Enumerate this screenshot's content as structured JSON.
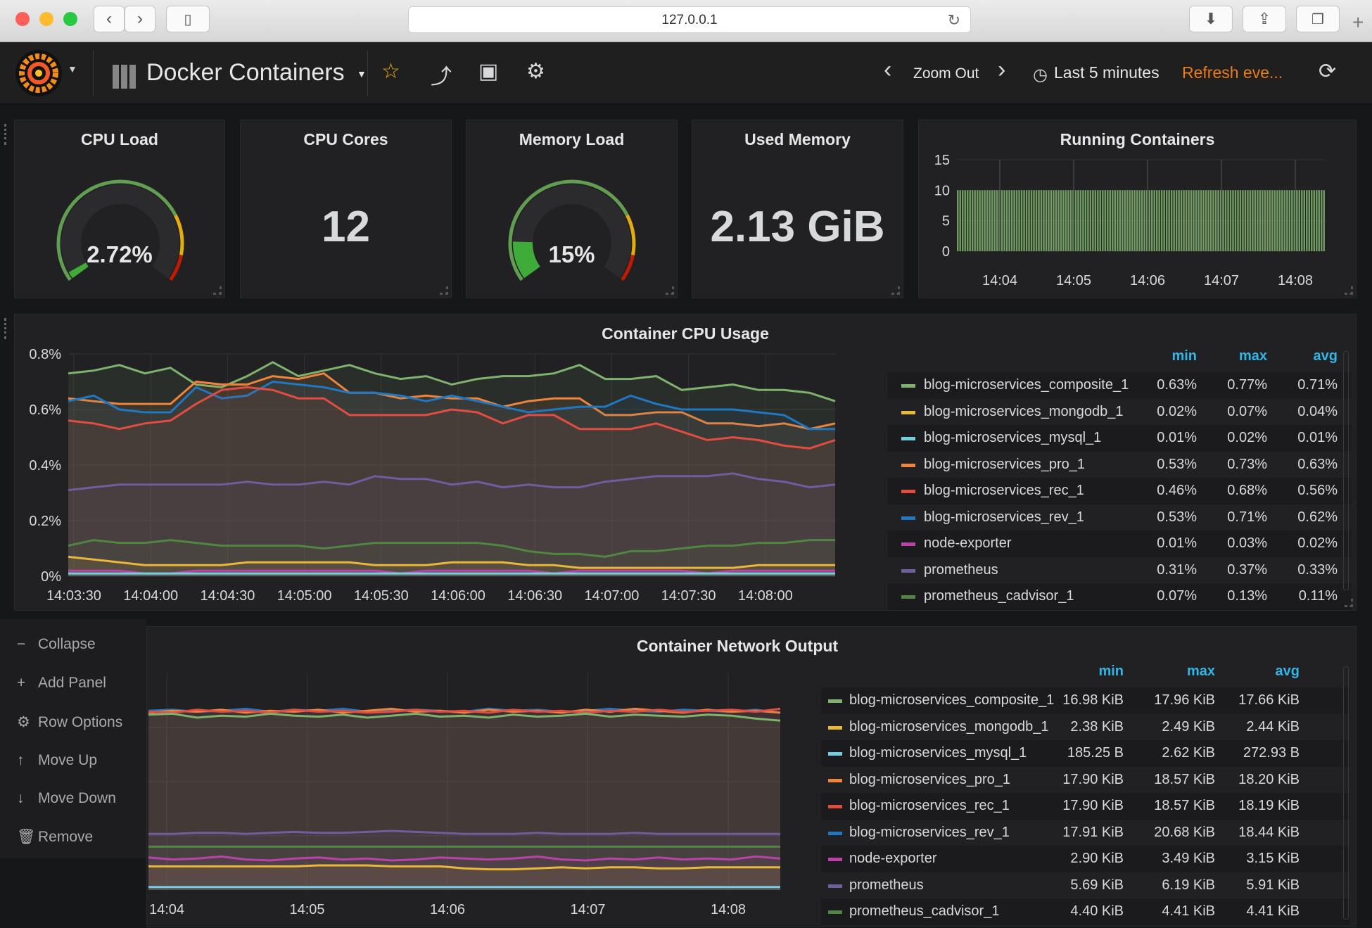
{
  "browser": {
    "url": "127.0.0.1"
  },
  "navbar": {
    "dashboard_title": "Docker Containers",
    "zoom_out": "Zoom Out",
    "time_range": "Last 5 minutes",
    "refresh": "Refresh eve..."
  },
  "stats": {
    "cpu_load": {
      "title": "CPU Load",
      "value": "2.72%",
      "fraction": 0.0272
    },
    "cpu_cores": {
      "title": "CPU Cores",
      "value": "12"
    },
    "memory_load": {
      "title": "Memory Load",
      "value": "15%",
      "fraction": 0.15
    },
    "used_memory": {
      "title": "Used Memory",
      "value": "2.13 GiB"
    },
    "running_containers": {
      "title": "Running Containers"
    }
  },
  "colors": {
    "green": "#7eb26d",
    "yellow": "#eab839",
    "cyan": "#6ed0e0",
    "orange": "#ef843c",
    "red": "#e24d42",
    "blue": "#1f78c1",
    "pink": "#ba43a9",
    "purple": "#705da0",
    "darkgreen": "#508642",
    "legend_header": "#33b5e5",
    "refresh": "#eb7b18"
  },
  "cpu_panel": {
    "title": "Container CPU Usage",
    "headers": {
      "min": "min",
      "max": "max",
      "avg": "avg"
    },
    "legend": [
      {
        "name": "blog-microservices_composite_1",
        "min": "0.63%",
        "max": "0.77%",
        "avg": "0.71%"
      },
      {
        "name": "blog-microservices_mongodb_1",
        "min": "0.02%",
        "max": "0.07%",
        "avg": "0.04%"
      },
      {
        "name": "blog-microservices_mysql_1",
        "min": "0.01%",
        "max": "0.02%",
        "avg": "0.01%"
      },
      {
        "name": "blog-microservices_pro_1",
        "min": "0.53%",
        "max": "0.73%",
        "avg": "0.63%"
      },
      {
        "name": "blog-microservices_rec_1",
        "min": "0.46%",
        "max": "0.68%",
        "avg": "0.56%"
      },
      {
        "name": "blog-microservices_rev_1",
        "min": "0.53%",
        "max": "0.71%",
        "avg": "0.62%"
      },
      {
        "name": "node-exporter",
        "min": "0.01%",
        "max": "0.03%",
        "avg": "0.02%"
      },
      {
        "name": "prometheus",
        "min": "0.31%",
        "max": "0.37%",
        "avg": "0.33%"
      },
      {
        "name": "prometheus_cadvisor_1",
        "min": "0.07%",
        "max": "0.13%",
        "avg": "0.11%"
      }
    ]
  },
  "net_panel": {
    "title": "Container Network Output",
    "headers": {
      "min": "min",
      "max": "max",
      "avg": "avg"
    },
    "legend": [
      {
        "name": "blog-microservices_composite_1",
        "min": "16.98 KiB",
        "max": "17.96 KiB",
        "avg": "17.66 KiB"
      },
      {
        "name": "blog-microservices_mongodb_1",
        "min": "2.38 KiB",
        "max": "2.49 KiB",
        "avg": "2.44 KiB"
      },
      {
        "name": "blog-microservices_mysql_1",
        "min": "185.25 B",
        "max": "2.62 KiB",
        "avg": "272.93 B"
      },
      {
        "name": "blog-microservices_pro_1",
        "min": "17.90 KiB",
        "max": "18.57 KiB",
        "avg": "18.20 KiB"
      },
      {
        "name": "blog-microservices_rec_1",
        "min": "17.90 KiB",
        "max": "18.57 KiB",
        "avg": "18.19 KiB"
      },
      {
        "name": "blog-microservices_rev_1",
        "min": "17.91 KiB",
        "max": "20.68 KiB",
        "avg": "18.44 KiB"
      },
      {
        "name": "node-exporter",
        "min": "2.90 KiB",
        "max": "3.49 KiB",
        "avg": "3.15 KiB"
      },
      {
        "name": "prometheus",
        "min": "5.69 KiB",
        "max": "6.19 KiB",
        "avg": "5.91 KiB"
      },
      {
        "name": "prometheus_cadvisor_1",
        "min": "4.40 KiB",
        "max": "4.41 KiB",
        "avg": "4.41 KiB"
      }
    ]
  },
  "row_menu": {
    "collapse": "Collapse",
    "add_panel": "Add Panel",
    "row_options": "Row Options",
    "move_up": "Move Up",
    "move_down": "Move Down",
    "remove": "Remove"
  },
  "chart_data": [
    {
      "type": "bar",
      "title": "Running Containers",
      "x_ticks": [
        "14:04",
        "14:05",
        "14:06",
        "14:07",
        "14:08"
      ],
      "y_ticks": [
        "0",
        "5",
        "10",
        "15"
      ],
      "ylim": [
        0,
        15
      ],
      "value_constant": 10
    },
    {
      "type": "area",
      "title": "Container CPU Usage",
      "x_ticks": [
        "14:03:30",
        "14:04:00",
        "14:04:30",
        "14:05:00",
        "14:05:30",
        "14:06:00",
        "14:06:30",
        "14:07:00",
        "14:07:30",
        "14:08:00"
      ],
      "y_ticks": [
        "0%",
        "0.2%",
        "0.4%",
        "0.6%",
        "0.8%"
      ],
      "ylim": [
        0,
        0.8
      ],
      "series": [
        {
          "name": "blog-microservices_composite_1",
          "color": "#7eb26d",
          "values": [
            0.73,
            0.74,
            0.76,
            0.73,
            0.75,
            0.69,
            0.68,
            0.72,
            0.77,
            0.72,
            0.74,
            0.76,
            0.73,
            0.71,
            0.72,
            0.69,
            0.71,
            0.72,
            0.72,
            0.73,
            0.76,
            0.71,
            0.71,
            0.72,
            0.67,
            0.68,
            0.69,
            0.67,
            0.67,
            0.66,
            0.63
          ]
        },
        {
          "name": "blog-microservices_pro_1",
          "color": "#ef843c",
          "values": [
            0.64,
            0.63,
            0.62,
            0.62,
            0.62,
            0.7,
            0.69,
            0.69,
            0.72,
            0.71,
            0.73,
            0.66,
            0.66,
            0.64,
            0.65,
            0.64,
            0.64,
            0.61,
            0.63,
            0.64,
            0.64,
            0.58,
            0.58,
            0.59,
            0.59,
            0.55,
            0.55,
            0.54,
            0.55,
            0.53,
            0.55
          ]
        },
        {
          "name": "blog-microservices_rev_1",
          "color": "#1f78c1",
          "values": [
            0.63,
            0.65,
            0.6,
            0.59,
            0.59,
            0.68,
            0.64,
            0.65,
            0.7,
            0.69,
            0.68,
            0.66,
            0.66,
            0.65,
            0.63,
            0.65,
            0.63,
            0.61,
            0.59,
            0.6,
            0.61,
            0.61,
            0.65,
            0.62,
            0.6,
            0.6,
            0.6,
            0.59,
            0.58,
            0.53,
            0.53
          ]
        },
        {
          "name": "blog-microservices_rec_1",
          "color": "#e24d42",
          "values": [
            0.56,
            0.55,
            0.53,
            0.55,
            0.56,
            0.62,
            0.67,
            0.68,
            0.67,
            0.64,
            0.64,
            0.58,
            0.58,
            0.58,
            0.58,
            0.6,
            0.59,
            0.55,
            0.58,
            0.58,
            0.53,
            0.53,
            0.53,
            0.55,
            0.52,
            0.49,
            0.5,
            0.49,
            0.47,
            0.46,
            0.49
          ]
        },
        {
          "name": "prometheus",
          "color": "#705da0",
          "values": [
            0.31,
            0.32,
            0.33,
            0.33,
            0.33,
            0.33,
            0.33,
            0.34,
            0.33,
            0.33,
            0.34,
            0.33,
            0.36,
            0.35,
            0.35,
            0.33,
            0.34,
            0.32,
            0.33,
            0.32,
            0.32,
            0.34,
            0.35,
            0.36,
            0.36,
            0.36,
            0.37,
            0.35,
            0.34,
            0.32,
            0.33
          ]
        },
        {
          "name": "prometheus_cadvisor_1",
          "color": "#508642",
          "values": [
            0.11,
            0.13,
            0.12,
            0.12,
            0.13,
            0.12,
            0.11,
            0.11,
            0.11,
            0.11,
            0.1,
            0.11,
            0.12,
            0.12,
            0.12,
            0.12,
            0.12,
            0.11,
            0.09,
            0.08,
            0.08,
            0.07,
            0.09,
            0.09,
            0.1,
            0.11,
            0.11,
            0.12,
            0.12,
            0.13,
            0.13
          ]
        },
        {
          "name": "blog-microservices_mongodb_1",
          "color": "#eab839",
          "values": [
            0.07,
            0.06,
            0.05,
            0.04,
            0.04,
            0.04,
            0.04,
            0.05,
            0.05,
            0.05,
            0.05,
            0.05,
            0.04,
            0.04,
            0.04,
            0.05,
            0.05,
            0.05,
            0.04,
            0.04,
            0.03,
            0.03,
            0.03,
            0.03,
            0.03,
            0.03,
            0.03,
            0.04,
            0.04,
            0.04,
            0.04
          ]
        },
        {
          "name": "node-exporter",
          "color": "#ba43a9",
          "values": [
            0.02,
            0.02,
            0.02,
            0.01,
            0.01,
            0.02,
            0.02,
            0.02,
            0.02,
            0.02,
            0.02,
            0.02,
            0.02,
            0.01,
            0.02,
            0.02,
            0.02,
            0.02,
            0.02,
            0.01,
            0.02,
            0.02,
            0.02,
            0.02,
            0.02,
            0.01,
            0.02,
            0.02,
            0.02,
            0.02,
            0.02
          ]
        },
        {
          "name": "blog-microservices_mysql_1",
          "color": "#6ed0e0",
          "values": [
            0.01,
            0.01,
            0.01,
            0.01,
            0.01,
            0.01,
            0.01,
            0.01,
            0.01,
            0.01,
            0.01,
            0.01,
            0.01,
            0.01,
            0.01,
            0.01,
            0.01,
            0.01,
            0.01,
            0.01,
            0.01,
            0.01,
            0.01,
            0.01,
            0.01,
            0.01,
            0.01,
            0.01,
            0.01,
            0.01,
            0.01
          ]
        }
      ]
    },
    {
      "type": "area",
      "title": "Container Network Output",
      "x_ticks": [
        "14:04",
        "14:05",
        "14:06",
        "14:07",
        "14:08"
      ],
      "ylim": [
        0,
        22
      ],
      "series": [
        {
          "name": "blog-microservices_rev_1",
          "color": "#1f78c1",
          "values": [
            18.2,
            18.3,
            18.1,
            18.2,
            18.4,
            18.1,
            18.3,
            18.2,
            18.4,
            18.1,
            18.2,
            18.3,
            18.2,
            18.1,
            18.4,
            18.2,
            18.3,
            18.1,
            18.2,
            18.4,
            18.2,
            18.1,
            18.3,
            18.2,
            18.1,
            18.3,
            18.0
          ]
        },
        {
          "name": "blog-microservices_pro_1",
          "color": "#ef843c",
          "values": [
            18.0,
            18.2,
            18.1,
            18.3,
            18.0,
            18.2,
            18.1,
            18.3,
            18.0,
            18.2,
            18.4,
            18.1,
            18.2,
            18.0,
            18.3,
            18.1,
            18.2,
            18.0,
            18.3,
            18.1,
            18.4,
            18.2,
            18.0,
            18.3,
            18.1,
            18.2,
            18.0
          ]
        },
        {
          "name": "blog-microservices_rec_1",
          "color": "#e24d42",
          "values": [
            18.1,
            18.0,
            18.3,
            18.1,
            18.2,
            18.0,
            18.3,
            18.1,
            18.2,
            18.0,
            18.1,
            18.3,
            18.1,
            18.2,
            18.0,
            18.3,
            18.1,
            18.2,
            18.0,
            18.2,
            18.1,
            18.3,
            18.1,
            18.2,
            18.3,
            18.1,
            18.4
          ]
        },
        {
          "name": "blog-microservices_composite_1",
          "color": "#7eb26d",
          "values": [
            17.8,
            17.9,
            17.5,
            17.7,
            17.6,
            17.9,
            17.7,
            17.6,
            17.8,
            17.5,
            17.7,
            17.9,
            17.6,
            17.7,
            17.5,
            17.8,
            17.6,
            17.7,
            17.9,
            17.6,
            17.8,
            17.7,
            17.6,
            17.8,
            17.7,
            17.4,
            17.2
          ]
        },
        {
          "name": "prometheus",
          "color": "#705da0",
          "values": [
            5.7,
            5.7,
            5.8,
            5.8,
            5.7,
            5.8,
            5.9,
            5.8,
            5.8,
            5.9,
            6.0,
            5.9,
            5.8,
            5.7,
            5.7,
            5.7,
            5.8,
            5.7,
            5.7,
            5.7,
            5.8,
            5.7,
            5.7,
            5.7,
            5.7,
            5.7,
            5.7
          ]
        },
        {
          "name": "prometheus_cadvisor_1",
          "color": "#508642",
          "values": [
            4.4,
            4.4,
            4.4,
            4.4,
            4.4,
            4.4,
            4.4,
            4.4,
            4.4,
            4.4,
            4.4,
            4.4,
            4.4,
            4.4,
            4.4,
            4.4,
            4.4,
            4.4,
            4.4,
            4.4,
            4.4,
            4.4,
            4.4,
            4.4,
            4.4,
            4.4,
            4.4
          ]
        },
        {
          "name": "node-exporter",
          "color": "#ba43a9",
          "values": [
            3.3,
            3.1,
            3.2,
            3.4,
            3.1,
            3.0,
            3.2,
            3.3,
            3.1,
            3.2,
            3.0,
            3.1,
            3.3,
            3.2,
            3.1,
            3.2,
            3.4,
            3.1,
            3.0,
            3.2,
            3.1,
            3.3,
            3.1,
            3.2,
            3.1,
            3.4,
            3.2
          ]
        },
        {
          "name": "blog-microservices_mongodb_1",
          "color": "#eab839",
          "values": [
            2.4,
            2.4,
            2.4,
            2.4,
            2.4,
            2.4,
            2.4,
            2.5,
            2.5,
            2.5,
            2.4,
            2.4,
            2.4,
            2.2,
            2.1,
            2.1,
            2.2,
            2.3,
            2.2,
            2.3,
            2.3,
            2.2,
            2.2,
            2.3,
            2.3,
            2.3,
            2.3
          ]
        },
        {
          "name": "blog-microservices_mysql_1",
          "color": "#6ed0e0",
          "values": [
            0.3,
            0.3,
            0.3,
            0.3,
            0.3,
            0.3,
            0.3,
            0.3,
            0.3,
            0.3,
            0.3,
            0.3,
            0.3,
            0.3,
            0.3,
            0.3,
            0.3,
            0.3,
            0.3,
            0.3,
            0.3,
            0.3,
            0.3,
            0.3,
            0.3,
            0.3,
            0.3
          ]
        }
      ]
    }
  ]
}
